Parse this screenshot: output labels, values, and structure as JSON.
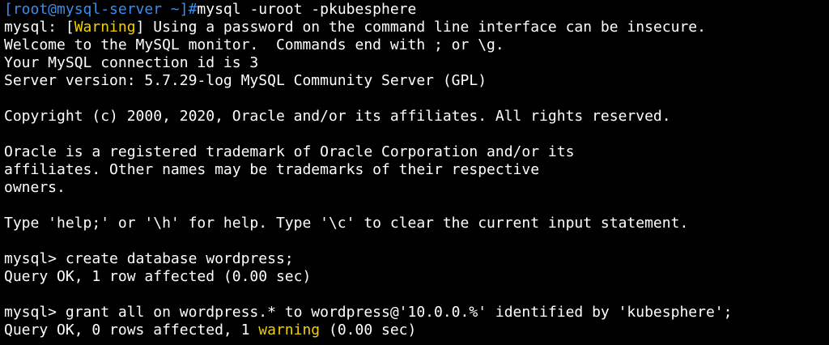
{
  "terminal": {
    "prompt": "[root@mysql-server ~]#",
    "command": "mysql -uroot -pkubesphere",
    "warning_line": {
      "prefix": "mysql: [",
      "tag": "Warning",
      "suffix": "] Using a password on the command line interface can be insecure."
    },
    "welcome": "Welcome to the MySQL monitor.  Commands end with ; or \\g.",
    "connection_id": "Your MySQL connection id is 3",
    "server_version": "Server version: 5.7.29-log MySQL Community Server (GPL)",
    "copyright": "Copyright (c) 2000, 2020, Oracle and/or its affiliates. All rights reserved.",
    "trademark": [
      "Oracle is a registered trademark of Oracle Corporation and/or its",
      "affiliates. Other names may be trademarks of their respective",
      "owners."
    ],
    "help_hint": "Type 'help;' or '\\h' for help. Type '\\c' to clear the current input statement.",
    "session": [
      {
        "prompt": "mysql> ",
        "statement": "create database wordpress;",
        "result": "Query OK, 1 row affected (0.00 sec)"
      },
      {
        "prompt": "mysql> ",
        "statement": "grant all on wordpress.* to wordpress@'10.0.0.%' identified by 'kubesphere';",
        "result_prefix": "Query OK, 0 rows affected, 1 ",
        "result_warning": "warning",
        "result_suffix": " (0.00 sec)"
      }
    ]
  },
  "colors": {
    "background": "#000000",
    "text": "#ffffff",
    "prompt": "#3b8eea",
    "warning": "#f0d000"
  }
}
